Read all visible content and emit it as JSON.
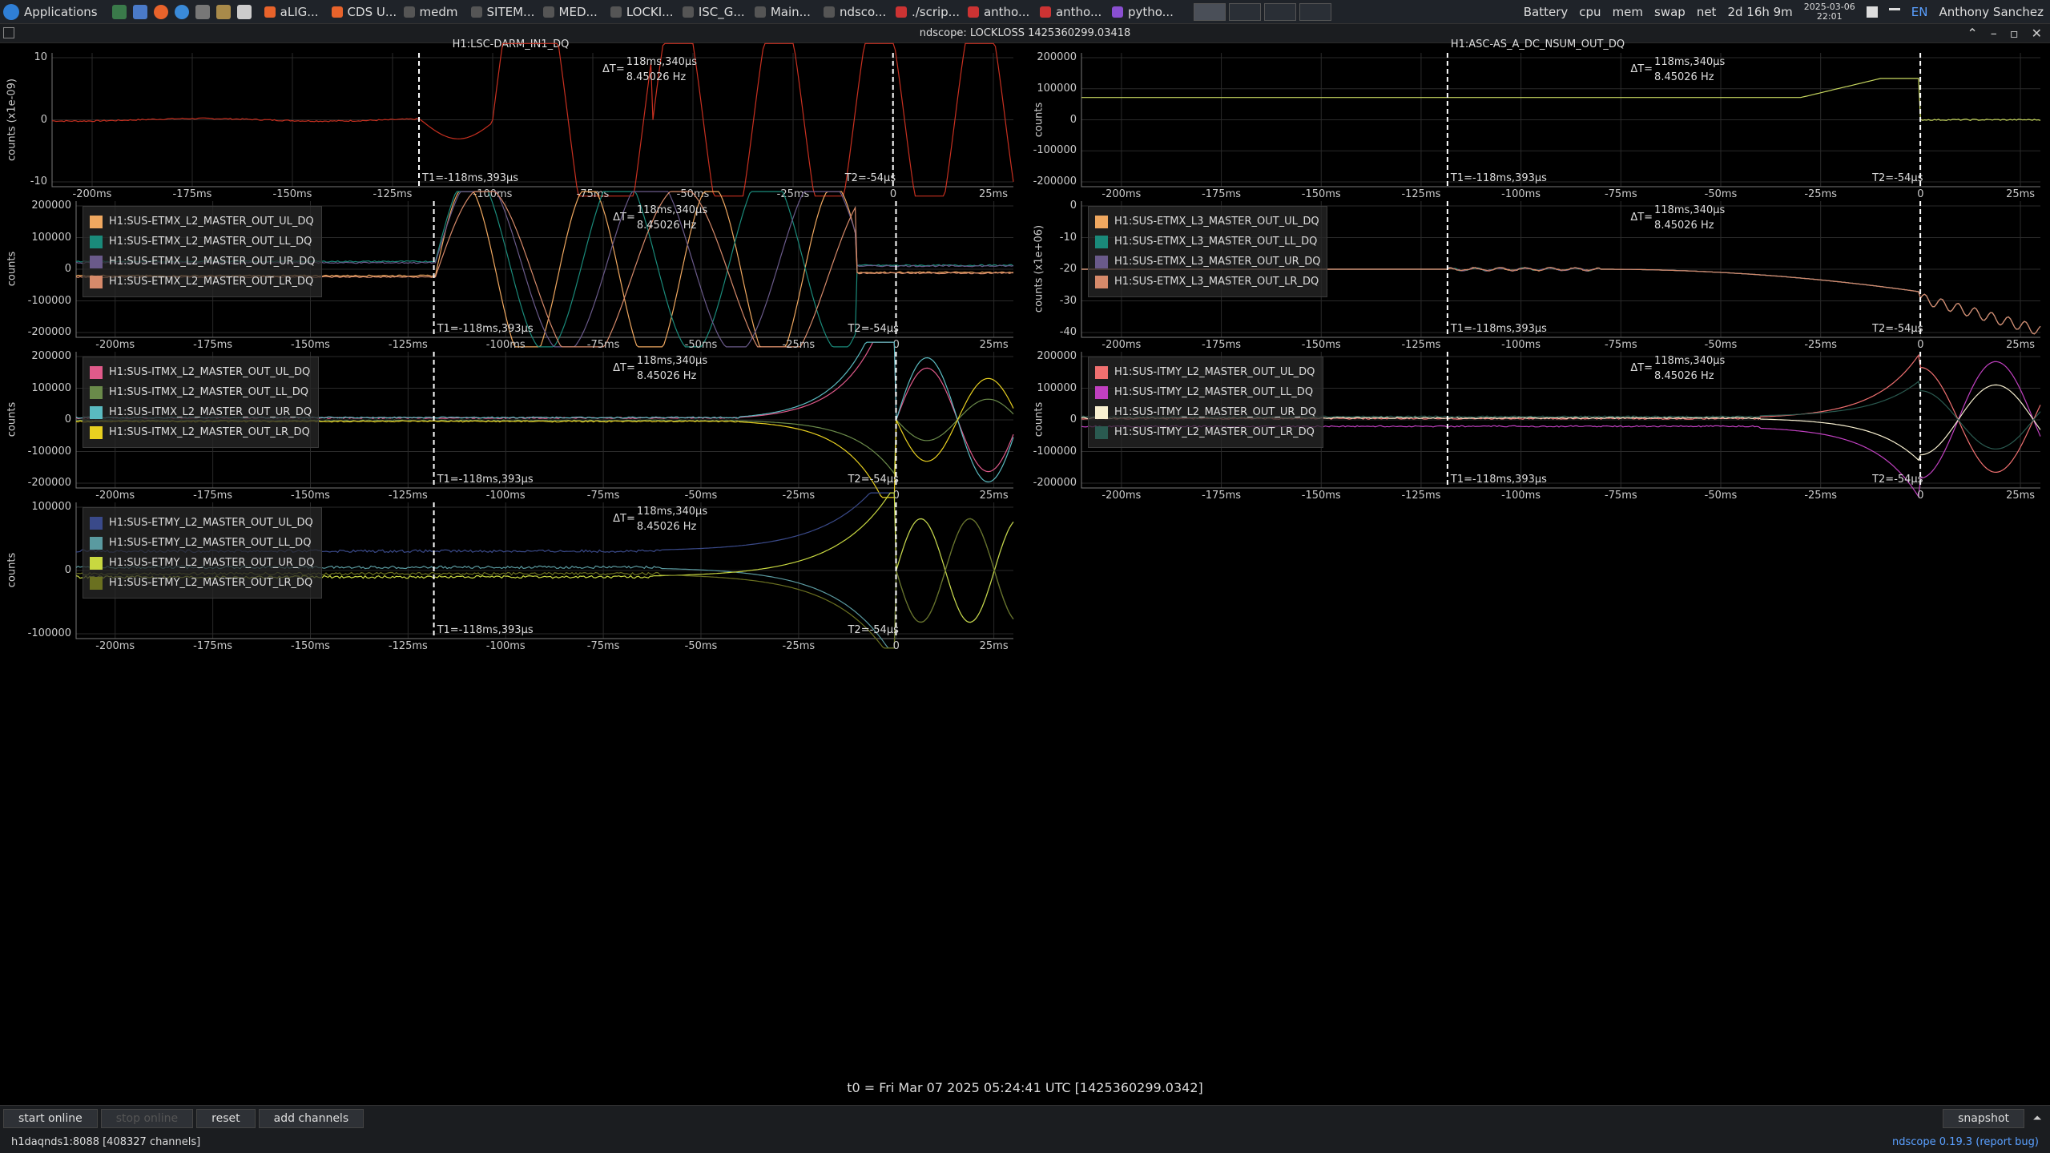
{
  "taskbar": {
    "applications_label": "Applications",
    "tasks": [
      {
        "label": "aLIG...",
        "color": "#e8632b"
      },
      {
        "label": "CDS U...",
        "color": "#e8632b"
      },
      {
        "label": "medm",
        "color": "#555"
      },
      {
        "label": "SITEM...",
        "color": "#555"
      },
      {
        "label": "MED...",
        "color": "#555"
      },
      {
        "label": "LOCKI...",
        "color": "#555"
      },
      {
        "label": "ISC_G...",
        "color": "#555"
      },
      {
        "label": "Main...",
        "color": "#555"
      },
      {
        "label": "ndsco...",
        "color": "#555"
      },
      {
        "label": "./scrip...",
        "color": "#c33"
      },
      {
        "label": "antho...",
        "color": "#c33"
      },
      {
        "label": "antho...",
        "color": "#c33"
      },
      {
        "label": "pytho...",
        "color": "#8a4fd1"
      }
    ],
    "indicators": [
      "Battery",
      "cpu",
      "mem",
      "swap",
      "net"
    ],
    "uptime": "2d 16h 9m",
    "date": "2025-03-06",
    "time": "22:01",
    "lang": "EN",
    "user": "Anthony Sanchez"
  },
  "window": {
    "title": "ndscope: LOCKLOSS 1425360299.03418"
  },
  "plots": [
    {
      "id": "darm",
      "title": "H1:LSC-DARM_IN1_DQ",
      "ylabel": "counts (x1e-09)",
      "yticks": [
        "10",
        "0",
        "-10"
      ],
      "legend": []
    },
    {
      "id": "asc",
      "title": "H1:ASC-AS_A_DC_NSUM_OUT_DQ",
      "ylabel": "counts",
      "yticks": [
        "200000",
        "100000",
        "0",
        "-100000",
        "-200000"
      ],
      "legend": []
    },
    {
      "id": "etmx_l2",
      "title": "",
      "ylabel": "counts",
      "yticks": [
        "200000",
        "100000",
        "0",
        "-100000",
        "-200000"
      ],
      "legend": [
        {
          "label": "H1:SUS-ETMX_L2_MASTER_OUT_UL_DQ",
          "color": "#f0a860"
        },
        {
          "label": "H1:SUS-ETMX_L2_MASTER_OUT_LL_DQ",
          "color": "#1a8a7a"
        },
        {
          "label": "H1:SUS-ETMX_L2_MASTER_OUT_UR_DQ",
          "color": "#6a5a8a"
        },
        {
          "label": "H1:SUS-ETMX_L2_MASTER_OUT_LR_DQ",
          "color": "#d68a6a"
        }
      ]
    },
    {
      "id": "etmx_l3",
      "title": "",
      "ylabel": "counts (x1e+06)",
      "yticks": [
        "0",
        "-10",
        "-20",
        "-30",
        "-40"
      ],
      "legend": [
        {
          "label": "H1:SUS-ETMX_L3_MASTER_OUT_UL_DQ",
          "color": "#f0a860"
        },
        {
          "label": "H1:SUS-ETMX_L3_MASTER_OUT_LL_DQ",
          "color": "#1a8a7a"
        },
        {
          "label": "H1:SUS-ETMX_L3_MASTER_OUT_UR_DQ",
          "color": "#6a5a8a"
        },
        {
          "label": "H1:SUS-ETMX_L3_MASTER_OUT_LR_DQ",
          "color": "#d68a6a"
        }
      ]
    },
    {
      "id": "itmx_l2",
      "title": "",
      "ylabel": "counts",
      "yticks": [
        "200000",
        "100000",
        "0",
        "-100000",
        "-200000"
      ],
      "legend": [
        {
          "label": "H1:SUS-ITMX_L2_MASTER_OUT_UL_DQ",
          "color": "#e05a8a"
        },
        {
          "label": "H1:SUS-ITMX_L2_MASTER_OUT_LL_DQ",
          "color": "#6a8a4a"
        },
        {
          "label": "H1:SUS-ITMX_L2_MASTER_OUT_UR_DQ",
          "color": "#5abac0"
        },
        {
          "label": "H1:SUS-ITMX_L2_MASTER_OUT_LR_DQ",
          "color": "#e8d020"
        }
      ]
    },
    {
      "id": "itmy_l2",
      "title": "",
      "ylabel": "counts",
      "yticks": [
        "200000",
        "100000",
        "0",
        "-100000",
        "-200000"
      ],
      "legend": [
        {
          "label": "H1:SUS-ITMY_L2_MASTER_OUT_UL_DQ",
          "color": "#f07070"
        },
        {
          "label": "H1:SUS-ITMY_L2_MASTER_OUT_LL_DQ",
          "color": "#c040c0"
        },
        {
          "label": "H1:SUS-ITMY_L2_MASTER_OUT_UR_DQ",
          "color": "#f8f0d0"
        },
        {
          "label": "H1:SUS-ITMY_L2_MASTER_OUT_LR_DQ",
          "color": "#2a5a50"
        }
      ]
    },
    {
      "id": "etmy_l2",
      "title": "",
      "ylabel": "counts",
      "yticks": [
        "100000",
        "0",
        "-100000"
      ],
      "legend": [
        {
          "label": "H1:SUS-ETMY_L2_MASTER_OUT_UL_DQ",
          "color": "#3a4a8a"
        },
        {
          "label": "H1:SUS-ETMY_L2_MASTER_OUT_LL_DQ",
          "color": "#5a9aa0"
        },
        {
          "label": "H1:SUS-ETMY_L2_MASTER_OUT_UR_DQ",
          "color": "#c8d840"
        },
        {
          "label": "H1:SUS-ETMY_L2_MASTER_OUT_LR_DQ",
          "color": "#6a7020"
        }
      ]
    }
  ],
  "xticks": [
    "-200ms",
    "-175ms",
    "-150ms",
    "-125ms",
    "-100ms",
    "-75ms",
    "-50ms",
    "-25ms",
    "0",
    "25ms"
  ],
  "cursors": {
    "t1": "T1=-118ms,393µs",
    "t2": "T2=-54µs",
    "dt_prefix": "ΔT=",
    "dt": "118ms,340µs",
    "freq": "8.45026 Hz"
  },
  "t0_label": "t0 = Fri Mar 07 2025 05:24:41 UTC [1425360299.0342]",
  "buttons": {
    "start_online": "start online",
    "stop_online": "stop online",
    "reset": "reset",
    "add_channels": "add channels",
    "snapshot": "snapshot"
  },
  "status": {
    "server": "h1daqnds1:8088  [408327 channels]",
    "version": "ndscope 0.19.3",
    "report": "(report bug)"
  },
  "colors": {
    "darm_trace": "#c83020",
    "asc_trace": "#c8d860",
    "cursor": "#ffffff",
    "grid": "#2a2a2a"
  }
}
